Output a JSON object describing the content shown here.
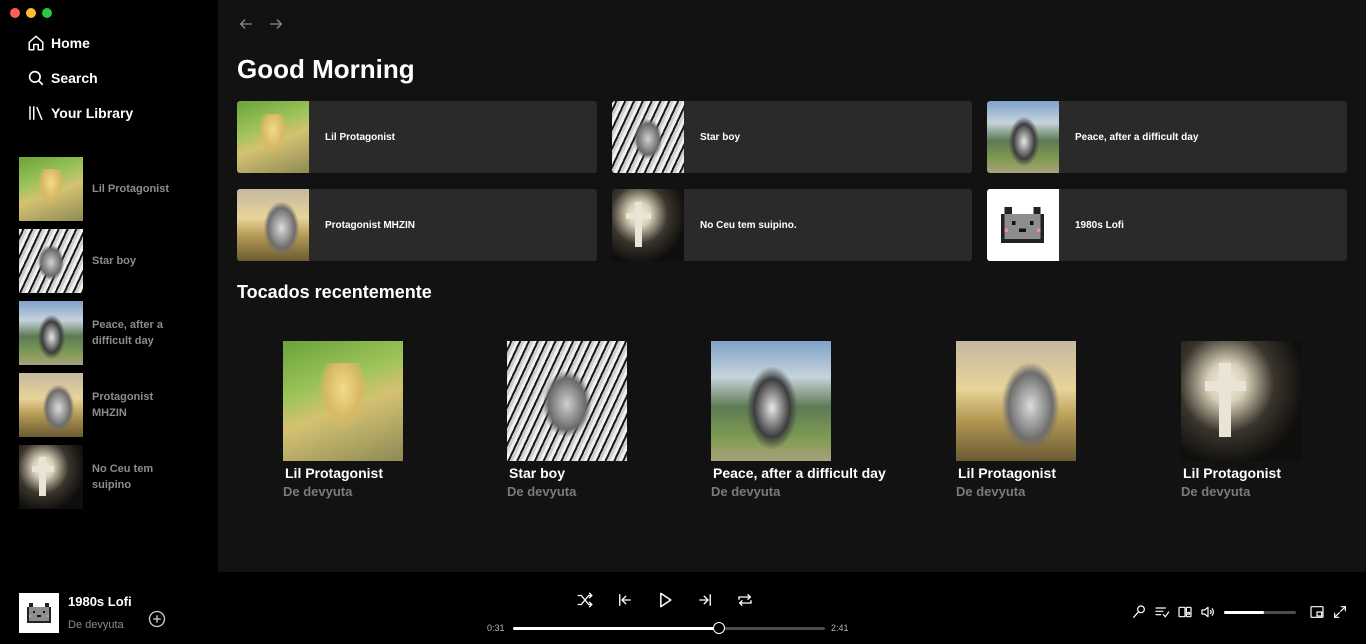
{
  "window": {
    "controls": [
      "close",
      "minimize",
      "zoom"
    ]
  },
  "nav": {
    "home": "Home",
    "search": "Search",
    "library": "Your Library"
  },
  "sidebar": {
    "items": [
      {
        "label": "Lil Protagonist"
      },
      {
        "label": "Star boy"
      },
      {
        "label": "Peace, after a difficult day"
      },
      {
        "label": "Protagonist MHZIN"
      },
      {
        "label": "No Ceu tem suipino"
      }
    ]
  },
  "main": {
    "greeting": "Good Morning",
    "quick": [
      {
        "label": "Lil Protagonist"
      },
      {
        "label": "Star boy"
      },
      {
        "label": "Peace, after a difficult day"
      },
      {
        "label": "Protagonist MHZIN"
      },
      {
        "label": "No Ceu tem suipino."
      },
      {
        "label": "1980s Lofi"
      }
    ],
    "recent_title": "Tocados recentemente",
    "recent": [
      {
        "title": "Lil Protagonist",
        "sub": "De devyuta"
      },
      {
        "title": "Star boy",
        "sub": "De devyuta"
      },
      {
        "title": "Peace, after a difficult day",
        "sub": "De devyuta"
      },
      {
        "title": "Lil Protagonist",
        "sub": "De devyuta"
      },
      {
        "title": "Lil Protagonist",
        "sub": "De devyuta"
      }
    ]
  },
  "player": {
    "title": "1980s Lofi",
    "artist": "De devyuta",
    "elapsed": "0:31",
    "duration": "2:41",
    "progress": 0.66,
    "volume": 0.55
  },
  "colors": {
    "sidebar_bg": "#000000",
    "main_bg": "#121212",
    "card_bg": "#2a2a2a",
    "muted_text": "#8c8c8c"
  }
}
